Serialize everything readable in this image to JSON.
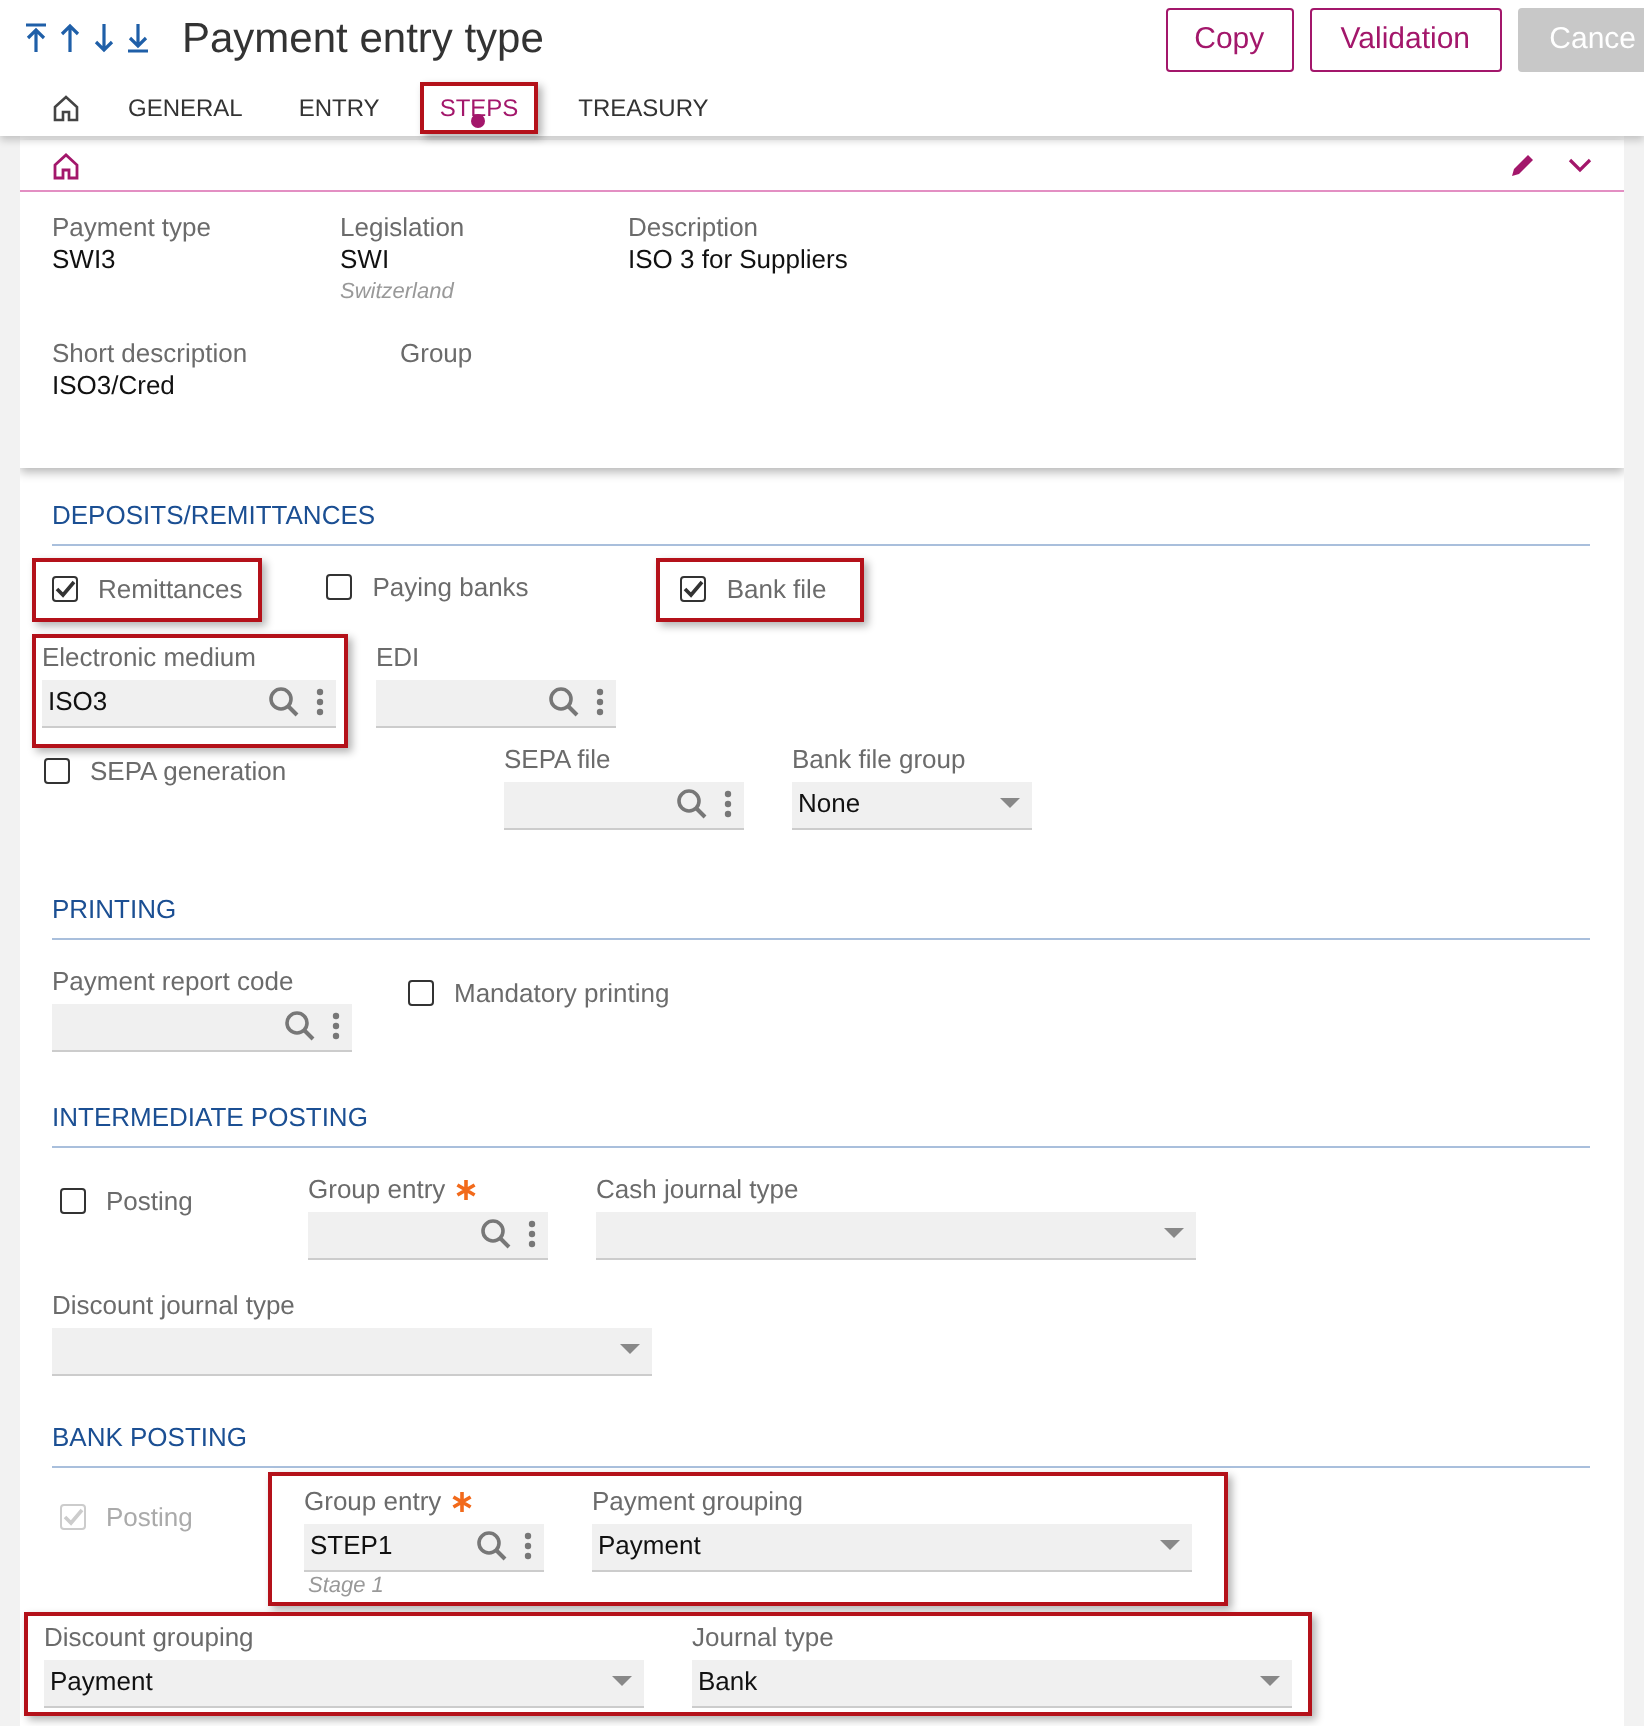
{
  "toolbar": {
    "title": "Payment entry type",
    "buttons": [
      {
        "label": "Copy",
        "disabled": false
      },
      {
        "label": "Validation",
        "disabled": false
      },
      {
        "label": "Cance",
        "disabled": true
      }
    ]
  },
  "tabs": [
    {
      "label": "GENERAL",
      "selected": false,
      "highlighted": false
    },
    {
      "label": "ENTRY",
      "selected": false,
      "highlighted": false
    },
    {
      "label": "STEPS",
      "selected": true,
      "highlighted": true
    },
    {
      "label": "TREASURY",
      "selected": false,
      "highlighted": false
    }
  ],
  "header_card": {
    "rows": [
      [
        {
          "label": "Payment type",
          "value": "SWI3"
        },
        {
          "label": "Legislation",
          "value": "SWI",
          "subtitle": "Switzerland"
        },
        {
          "label": "Description",
          "value": "ISO 3 for Suppliers"
        }
      ],
      [
        {
          "label": "Short description",
          "value": "ISO3/Cred"
        },
        {
          "label": "Group"
        }
      ]
    ]
  },
  "sections": [
    {
      "title": "DEPOSITS/REMITTANCES",
      "rows": [
        [
          {
            "kind": "checkbox",
            "label": "Remittances",
            "checked": true,
            "disabled": false,
            "highlighted": true
          },
          {
            "kind": "checkbox",
            "label": "Paying banks",
            "checked": false,
            "disabled": false,
            "highlighted": false
          },
          {
            "kind": "checkbox",
            "label": "Bank file",
            "checked": true,
            "disabled": false,
            "highlighted": true
          }
        ],
        [
          {
            "kind": "lookup",
            "label": "Electronic medium",
            "value": "ISO3",
            "highlighted": true
          },
          {
            "kind": "lookup",
            "label": "EDI",
            "highlighted": false
          }
        ],
        [
          {
            "kind": "checkbox",
            "label": "SEPA generation",
            "checked": false,
            "disabled": false,
            "highlighted": false
          },
          {
            "kind": "lookup",
            "label": "SEPA file",
            "highlighted": false
          },
          {
            "kind": "select",
            "label": "Bank file group",
            "value": "None",
            "highlighted": false
          }
        ]
      ]
    },
    {
      "title": "PRINTING",
      "rows": [
        [
          {
            "kind": "lookup",
            "label": "Payment report code",
            "highlighted": false
          },
          {
            "kind": "checkbox",
            "label": "Mandatory printing",
            "checked": false,
            "disabled": false,
            "highlighted": false
          }
        ]
      ]
    },
    {
      "title": "INTERMEDIATE POSTING",
      "rows": [
        [
          {
            "kind": "checkbox",
            "label": "Posting",
            "checked": false,
            "disabled": false,
            "highlighted": false
          },
          {
            "kind": "lookup",
            "label": "Group entry",
            "required": true,
            "highlighted": false
          },
          {
            "kind": "select",
            "label": "Cash journal type",
            "highlighted": false
          }
        ],
        [
          {
            "kind": "select",
            "label": "Discount journal type",
            "highlighted": false
          }
        ]
      ]
    },
    {
      "title": "BANK POSTING",
      "rows": [
        [
          {
            "kind": "checkbox",
            "label": "Posting",
            "checked": true,
            "disabled": true,
            "highlighted": false
          },
          {
            "kind": "group",
            "highlighted": true,
            "items": [
              {
                "kind": "lookup",
                "label": "Group entry",
                "value": "STEP1",
                "subtitle": "Stage 1",
                "required": true,
                "highlighted": false
              },
              {
                "kind": "select",
                "label": "Payment grouping",
                "value": "Payment",
                "highlighted": false
              }
            ]
          }
        ],
        [
          {
            "kind": "group",
            "highlighted": true,
            "items": [
              {
                "kind": "select",
                "label": "Discount grouping",
                "value": "Payment",
                "highlighted": false
              },
              {
                "kind": "select",
                "label": "Journal type",
                "value": "Bank",
                "highlighted": false
              }
            ]
          }
        ]
      ]
    }
  ]
}
